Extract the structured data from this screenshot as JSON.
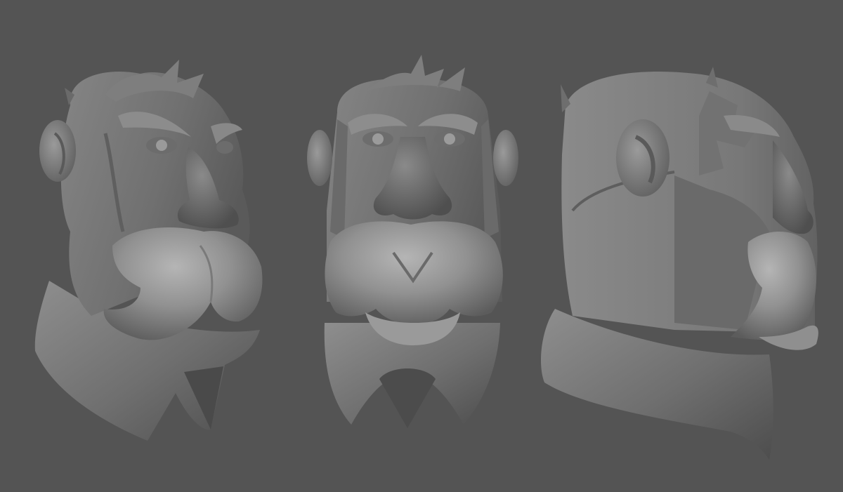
{
  "scene": {
    "background_color": "#545454",
    "material_color": "#7a7a7a",
    "views": [
      {
        "name": "three-quarter-view"
      },
      {
        "name": "front-view"
      },
      {
        "name": "side-view"
      }
    ]
  }
}
